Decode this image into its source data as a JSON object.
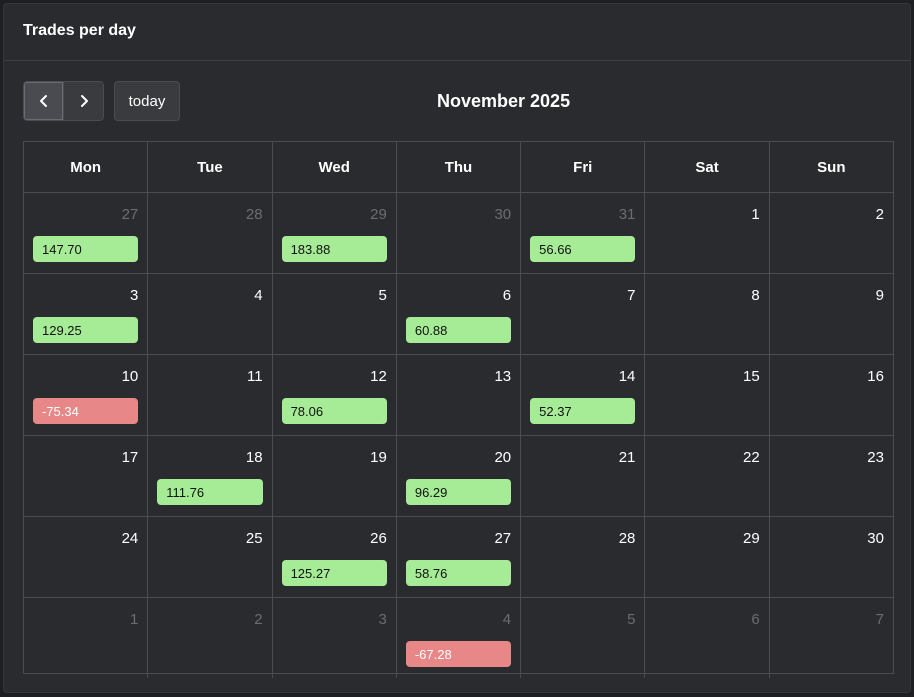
{
  "panel": {
    "title": "Trades per day"
  },
  "toolbar": {
    "today_label": "today",
    "month_title": "November 2025"
  },
  "colors": {
    "positive": "#a6ec96",
    "negative": "#e88787",
    "background": "#2a2b2f"
  },
  "weekdays": [
    "Mon",
    "Tue",
    "Wed",
    "Thu",
    "Fri",
    "Sat",
    "Sun"
  ],
  "weeks": [
    [
      {
        "day": "27",
        "other": true,
        "value": "147.70",
        "sign": "pos"
      },
      {
        "day": "28",
        "other": true
      },
      {
        "day": "29",
        "other": true,
        "value": "183.88",
        "sign": "pos"
      },
      {
        "day": "30",
        "other": true
      },
      {
        "day": "31",
        "other": true,
        "value": "56.66",
        "sign": "pos"
      },
      {
        "day": "1"
      },
      {
        "day": "2"
      }
    ],
    [
      {
        "day": "3",
        "value": "129.25",
        "sign": "pos"
      },
      {
        "day": "4"
      },
      {
        "day": "5"
      },
      {
        "day": "6",
        "value": "60.88",
        "sign": "pos"
      },
      {
        "day": "7"
      },
      {
        "day": "8"
      },
      {
        "day": "9"
      }
    ],
    [
      {
        "day": "10",
        "value": "-75.34",
        "sign": "neg"
      },
      {
        "day": "11"
      },
      {
        "day": "12",
        "value": "78.06",
        "sign": "pos"
      },
      {
        "day": "13"
      },
      {
        "day": "14",
        "value": "52.37",
        "sign": "pos"
      },
      {
        "day": "15"
      },
      {
        "day": "16"
      }
    ],
    [
      {
        "day": "17"
      },
      {
        "day": "18",
        "value": "111.76",
        "sign": "pos"
      },
      {
        "day": "19"
      },
      {
        "day": "20",
        "value": "96.29",
        "sign": "pos"
      },
      {
        "day": "21"
      },
      {
        "day": "22"
      },
      {
        "day": "23"
      }
    ],
    [
      {
        "day": "24"
      },
      {
        "day": "25"
      },
      {
        "day": "26",
        "value": "125.27",
        "sign": "pos"
      },
      {
        "day": "27",
        "value": "58.76",
        "sign": "pos"
      },
      {
        "day": "28"
      },
      {
        "day": "29"
      },
      {
        "day": "30"
      }
    ],
    [
      {
        "day": "1",
        "other": true
      },
      {
        "day": "2",
        "other": true
      },
      {
        "day": "3",
        "other": true
      },
      {
        "day": "4",
        "other": true,
        "value": "-67.28",
        "sign": "neg"
      },
      {
        "day": "5",
        "other": true
      },
      {
        "day": "6",
        "other": true
      },
      {
        "day": "7",
        "other": true
      }
    ]
  ]
}
